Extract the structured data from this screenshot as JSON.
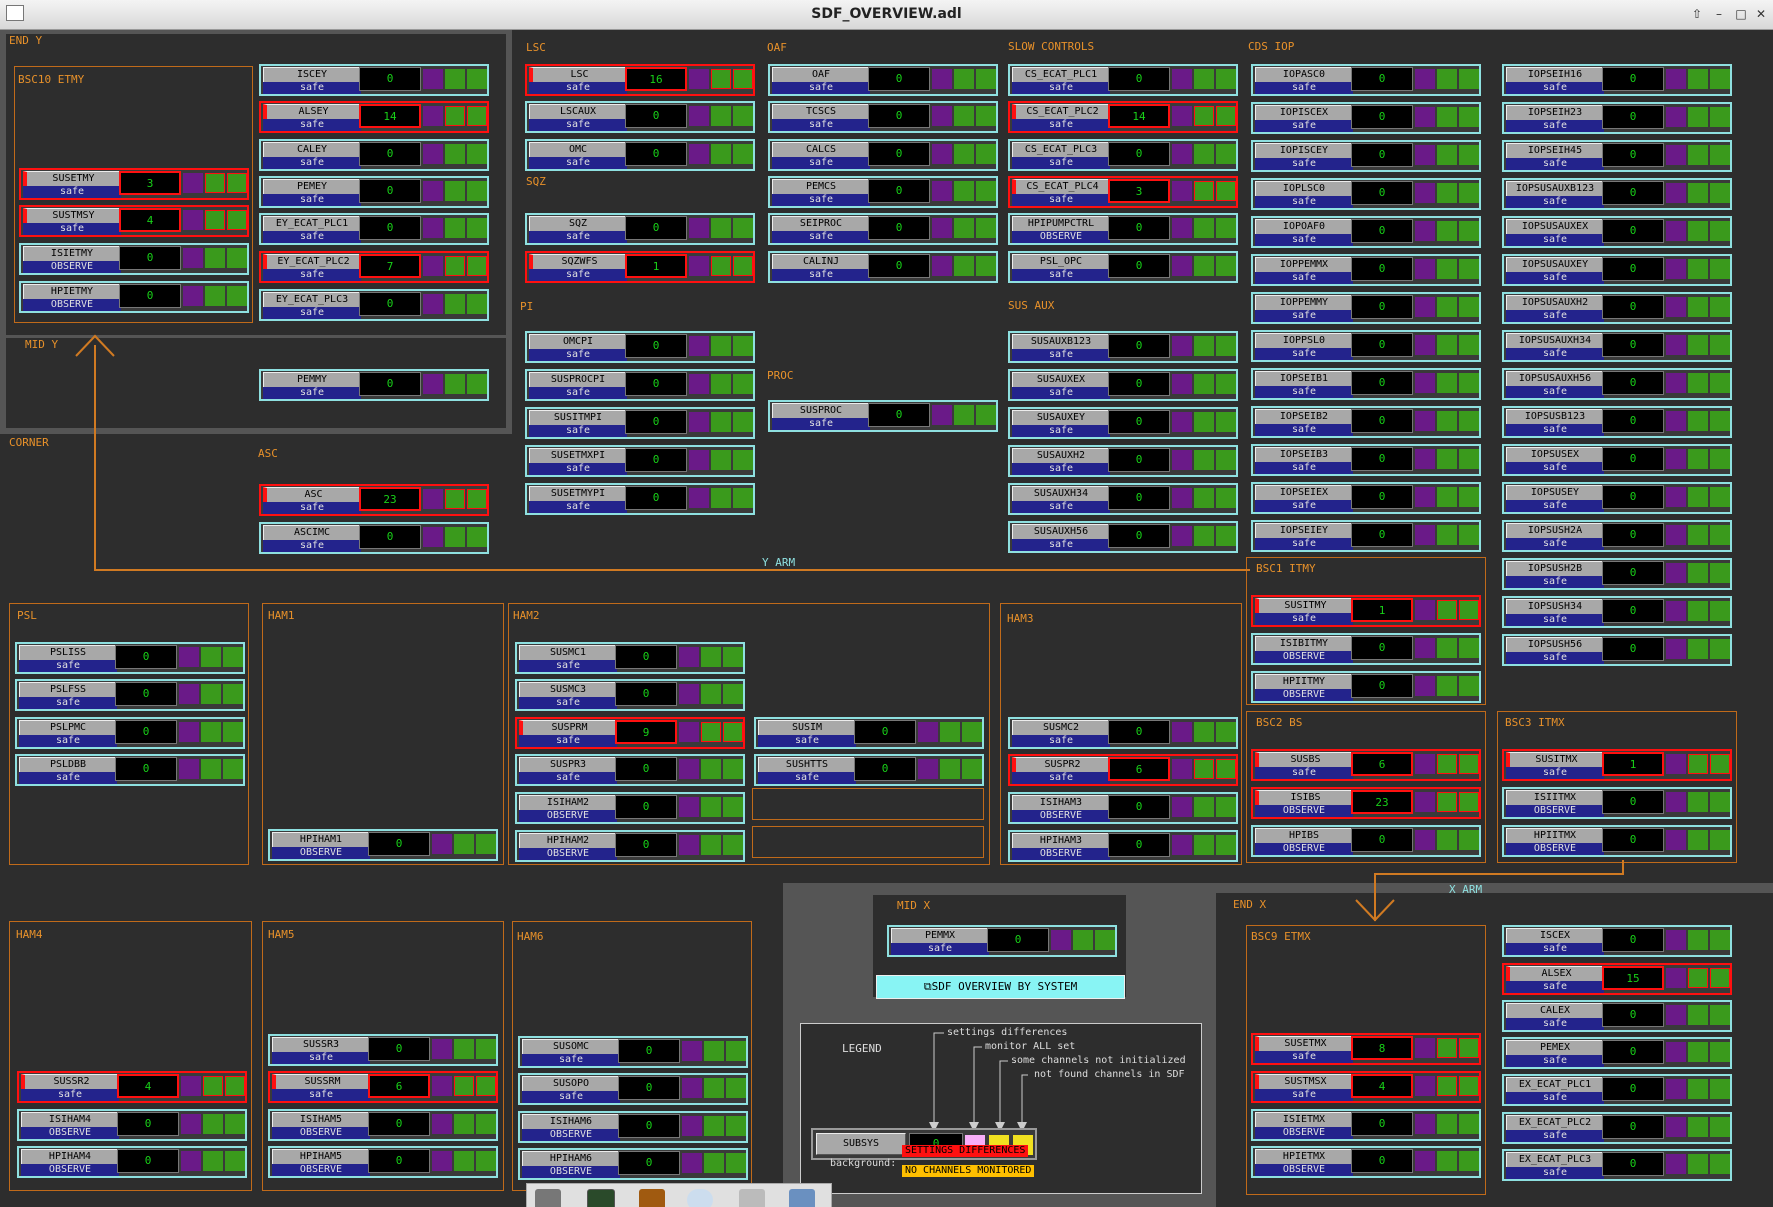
{
  "window": {
    "title": "SDF_OVERVIEW.adl"
  },
  "sections": {
    "end_y": "END Y",
    "bsc10": "BSC10 ETMY",
    "mid_y": "MID Y",
    "corner": "CORNER",
    "asc": "ASC",
    "lsc": "LSC",
    "sqz": "SQZ",
    "pi": "PI",
    "oaf": "OAF",
    "proc": "PROC",
    "slow": "SLOW CONTROLS",
    "sus_aux": "SUS AUX",
    "cds_iop": "CDS IOP",
    "y_arm": "Y ARM",
    "x_arm": "X ARM",
    "bsc1": "BSC1 ITMY",
    "bsc2": "BSC2 BS",
    "bsc3": "BSC3 ITMX",
    "psl": "PSL",
    "ham1": "HAM1",
    "ham2": "HAM2",
    "ham3": "HAM3",
    "ham4": "HAM4",
    "ham5": "HAM5",
    "ham6": "HAM6",
    "mid_x": "MID X",
    "end_x": "END X",
    "bsc9": "BSC9 ETMX"
  },
  "button": {
    "overview_label": "SDF OVERVIEW BY SYSTEM"
  },
  "legend": {
    "title": "LEGEND",
    "settings_diff": "settings differences",
    "monitor_all": "monitor ALL set",
    "not_init": "some channels not initialized",
    "not_found": "not found channels in SDF",
    "sample_name": "SUBSYS",
    "sample_count": "0",
    "background_label": "background:",
    "bg_settings": "SETTINGS DIFFERENCES",
    "bg_no_channels": "NO CHANNELS MONITORED"
  },
  "widgets": [
    {
      "n": "SUSETMY",
      "s": "safe",
      "c": "3",
      "a": 1
    },
    {
      "n": "SUSTMSY",
      "s": "safe",
      "c": "4",
      "a": 1
    },
    {
      "n": "ISIETMY",
      "s": "OBSERVE",
      "c": "0",
      "a": 0
    },
    {
      "n": "HPIETMY",
      "s": "OBSERVE",
      "c": "0",
      "a": 0
    },
    {
      "n": "ISCEY",
      "s": "safe",
      "c": "0",
      "a": 0
    },
    {
      "n": "ALSEY",
      "s": "safe",
      "c": "14",
      "a": 1
    },
    {
      "n": "CALEY",
      "s": "safe",
      "c": "0",
      "a": 0
    },
    {
      "n": "PEMEY",
      "s": "safe",
      "c": "0",
      "a": 0
    },
    {
      "n": "EY_ECAT_PLC1",
      "s": "safe",
      "c": "0",
      "a": 0
    },
    {
      "n": "EY_ECAT_PLC2",
      "s": "safe",
      "c": "7",
      "a": 1
    },
    {
      "n": "EY_ECAT_PLC3",
      "s": "safe",
      "c": "0",
      "a": 0
    },
    {
      "n": "PEMMY",
      "s": "safe",
      "c": "0",
      "a": 0
    },
    {
      "n": "ASC",
      "s": "safe",
      "c": "23",
      "a": 1
    },
    {
      "n": "ASCIMC",
      "s": "safe",
      "c": "0",
      "a": 0
    },
    {
      "n": "LSC",
      "s": "safe",
      "c": "16",
      "a": 1
    },
    {
      "n": "LSCAUX",
      "s": "safe",
      "c": "0",
      "a": 0
    },
    {
      "n": "OMC",
      "s": "safe",
      "c": "0",
      "a": 0
    },
    {
      "n": "SQZ",
      "s": "safe",
      "c": "0",
      "a": 0
    },
    {
      "n": "SQZWFS",
      "s": "safe",
      "c": "1",
      "a": 1
    },
    {
      "n": "OMCPI",
      "s": "safe",
      "c": "0",
      "a": 0
    },
    {
      "n": "SUSPROCPI",
      "s": "safe",
      "c": "0",
      "a": 0
    },
    {
      "n": "SUSITMPI",
      "s": "safe",
      "c": "0",
      "a": 0
    },
    {
      "n": "SUSETMXPI",
      "s": "safe",
      "c": "0",
      "a": 0
    },
    {
      "n": "SUSETMYPI",
      "s": "safe",
      "c": "0",
      "a": 0
    },
    {
      "n": "OAF",
      "s": "safe",
      "c": "0",
      "a": 0
    },
    {
      "n": "TCSCS",
      "s": "safe",
      "c": "0",
      "a": 0
    },
    {
      "n": "CALCS",
      "s": "safe",
      "c": "0",
      "a": 0
    },
    {
      "n": "PEMCS",
      "s": "safe",
      "c": "0",
      "a": 0
    },
    {
      "n": "SEIPROC",
      "s": "safe",
      "c": "0",
      "a": 0
    },
    {
      "n": "CALINJ",
      "s": "safe",
      "c": "0",
      "a": 0
    },
    {
      "n": "SUSPROC",
      "s": "safe",
      "c": "0",
      "a": 0
    },
    {
      "n": "CS_ECAT_PLC1",
      "s": "safe",
      "c": "0",
      "a": 0
    },
    {
      "n": "CS_ECAT_PLC2",
      "s": "safe",
      "c": "14",
      "a": 1
    },
    {
      "n": "CS_ECAT_PLC3",
      "s": "safe",
      "c": "0",
      "a": 0
    },
    {
      "n": "CS_ECAT_PLC4",
      "s": "safe",
      "c": "3",
      "a": 1
    },
    {
      "n": "HPIPUMPCTRL",
      "s": "OBSERVE",
      "c": "0",
      "a": 0
    },
    {
      "n": "PSL_OPC",
      "s": "safe",
      "c": "0",
      "a": 0
    },
    {
      "n": "SUSAUXB123",
      "s": "safe",
      "c": "0",
      "a": 0
    },
    {
      "n": "SUSAUXEX",
      "s": "safe",
      "c": "0",
      "a": 0
    },
    {
      "n": "SUSAUXEY",
      "s": "safe",
      "c": "0",
      "a": 0
    },
    {
      "n": "SUSAUXH2",
      "s": "safe",
      "c": "0",
      "a": 0
    },
    {
      "n": "SUSAUXH34",
      "s": "safe",
      "c": "0",
      "a": 0
    },
    {
      "n": "SUSAUXH56",
      "s": "safe",
      "c": "0",
      "a": 0
    },
    {
      "n": "IOPASC0",
      "s": "safe",
      "c": "0",
      "a": 0
    },
    {
      "n": "IOPISCEX",
      "s": "safe",
      "c": "0",
      "a": 0
    },
    {
      "n": "IOPISCEY",
      "s": "safe",
      "c": "0",
      "a": 0
    },
    {
      "n": "IOPLSC0",
      "s": "safe",
      "c": "0",
      "a": 0
    },
    {
      "n": "IOPOAF0",
      "s": "safe",
      "c": "0",
      "a": 0
    },
    {
      "n": "IOPPEMMX",
      "s": "safe",
      "c": "0",
      "a": 0
    },
    {
      "n": "IOPPEMMY",
      "s": "safe",
      "c": "0",
      "a": 0
    },
    {
      "n": "IOPPSL0",
      "s": "safe",
      "c": "0",
      "a": 0
    },
    {
      "n": "IOPSEIB1",
      "s": "safe",
      "c": "0",
      "a": 0
    },
    {
      "n": "IOPSEIB2",
      "s": "safe",
      "c": "0",
      "a": 0
    },
    {
      "n": "IOPSEIB3",
      "s": "safe",
      "c": "0",
      "a": 0
    },
    {
      "n": "IOPSEIEX",
      "s": "safe",
      "c": "0",
      "a": 0
    },
    {
      "n": "IOPSEIEY",
      "s": "safe",
      "c": "0",
      "a": 0
    },
    {
      "n": "IOPSEIH16",
      "s": "safe",
      "c": "0",
      "a": 0
    },
    {
      "n": "IOPSEIH23",
      "s": "safe",
      "c": "0",
      "a": 0
    },
    {
      "n": "IOPSEIH45",
      "s": "safe",
      "c": "0",
      "a": 0
    },
    {
      "n": "IOPSUSAUXB123",
      "s": "safe",
      "c": "0",
      "a": 0
    },
    {
      "n": "IOPSUSAUXEX",
      "s": "safe",
      "c": "0",
      "a": 0
    },
    {
      "n": "IOPSUSAUXEY",
      "s": "safe",
      "c": "0",
      "a": 0
    },
    {
      "n": "IOPSUSAUXH2",
      "s": "safe",
      "c": "0",
      "a": 0
    },
    {
      "n": "IOPSUSAUXH34",
      "s": "safe",
      "c": "0",
      "a": 0
    },
    {
      "n": "IOPSUSAUXH56",
      "s": "safe",
      "c": "0",
      "a": 0
    },
    {
      "n": "IOPSUSB123",
      "s": "safe",
      "c": "0",
      "a": 0
    },
    {
      "n": "IOPSUSEX",
      "s": "safe",
      "c": "0",
      "a": 0
    },
    {
      "n": "IOPSUSEY",
      "s": "safe",
      "c": "0",
      "a": 0
    },
    {
      "n": "IOPSUSH2A",
      "s": "safe",
      "c": "0",
      "a": 0
    },
    {
      "n": "IOPSUSH2B",
      "s": "safe",
      "c": "0",
      "a": 0
    },
    {
      "n": "IOPSUSH34",
      "s": "safe",
      "c": "0",
      "a": 0
    },
    {
      "n": "IOPSUSH56",
      "s": "safe",
      "c": "0",
      "a": 0
    },
    {
      "n": "SUSITMY",
      "s": "safe",
      "c": "1",
      "a": 1
    },
    {
      "n": "ISIBITMY",
      "s": "OBSERVE",
      "c": "0",
      "a": 0
    },
    {
      "n": "HPIITMY",
      "s": "OBSERVE",
      "c": "0",
      "a": 0
    },
    {
      "n": "SUSBS",
      "s": "safe",
      "c": "6",
      "a": 1
    },
    {
      "n": "ISIBS",
      "s": "OBSERVE",
      "c": "23",
      "a": 1
    },
    {
      "n": "HPIBS",
      "s": "OBSERVE",
      "c": "0",
      "a": 0
    },
    {
      "n": "SUSITMX",
      "s": "safe",
      "c": "1",
      "a": 1
    },
    {
      "n": "ISIITMX",
      "s": "OBSERVE",
      "c": "0",
      "a": 0
    },
    {
      "n": "HPIITMX",
      "s": "OBSERVE",
      "c": "0",
      "a": 0
    },
    {
      "n": "PSLISS",
      "s": "safe",
      "c": "0",
      "a": 0
    },
    {
      "n": "PSLFSS",
      "s": "safe",
      "c": "0",
      "a": 0
    },
    {
      "n": "PSLPMC",
      "s": "safe",
      "c": "0",
      "a": 0
    },
    {
      "n": "PSLDBB",
      "s": "safe",
      "c": "0",
      "a": 0
    },
    {
      "n": "HPIHAM1",
      "s": "OBSERVE",
      "c": "0",
      "a": 0
    },
    {
      "n": "SUSMC1",
      "s": "safe",
      "c": "0",
      "a": 0
    },
    {
      "n": "SUSMC3",
      "s": "safe",
      "c": "0",
      "a": 0
    },
    {
      "n": "SUSPRM",
      "s": "safe",
      "c": "9",
      "a": 1
    },
    {
      "n": "SUSPR3",
      "s": "safe",
      "c": "0",
      "a": 0
    },
    {
      "n": "ISIHAM2",
      "s": "OBSERVE",
      "c": "0",
      "a": 0
    },
    {
      "n": "HPIHAM2",
      "s": "OBSERVE",
      "c": "0",
      "a": 0
    },
    {
      "n": "SUSIM",
      "s": "safe",
      "c": "0",
      "a": 0
    },
    {
      "n": "SUSHTTS",
      "s": "safe",
      "c": "0",
      "a": 0
    },
    {
      "n": "SUSMC2",
      "s": "safe",
      "c": "0",
      "a": 0
    },
    {
      "n": "SUSPR2",
      "s": "safe",
      "c": "6",
      "a": 1
    },
    {
      "n": "ISIHAM3",
      "s": "OBSERVE",
      "c": "0",
      "a": 0
    },
    {
      "n": "HPIHAM3",
      "s": "OBSERVE",
      "c": "0",
      "a": 0
    },
    {
      "n": "SUSSR2",
      "s": "safe",
      "c": "4",
      "a": 1
    },
    {
      "n": "ISIHAM4",
      "s": "OBSERVE",
      "c": "0",
      "a": 0
    },
    {
      "n": "HPIHAM4",
      "s": "OBSERVE",
      "c": "0",
      "a": 0
    },
    {
      "n": "SUSSR3",
      "s": "safe",
      "c": "0",
      "a": 0
    },
    {
      "n": "SUSSRM",
      "s": "safe",
      "c": "6",
      "a": 1
    },
    {
      "n": "ISIHAM5",
      "s": "OBSERVE",
      "c": "0",
      "a": 0
    },
    {
      "n": "HPIHAM5",
      "s": "OBSERVE",
      "c": "0",
      "a": 0
    },
    {
      "n": "SUSOMC",
      "s": "safe",
      "c": "0",
      "a": 0
    },
    {
      "n": "SUSOPO",
      "s": "safe",
      "c": "0",
      "a": 0
    },
    {
      "n": "ISIHAM6",
      "s": "OBSERVE",
      "c": "0",
      "a": 0
    },
    {
      "n": "HPIHAM6",
      "s": "OBSERVE",
      "c": "0",
      "a": 0
    },
    {
      "n": "PEMMX",
      "s": "safe",
      "c": "0",
      "a": 0
    },
    {
      "n": "SUSETMX",
      "s": "safe",
      "c": "8",
      "a": 1
    },
    {
      "n": "SUSTMSX",
      "s": "safe",
      "c": "4",
      "a": 1
    },
    {
      "n": "ISIETMX",
      "s": "OBSERVE",
      "c": "0",
      "a": 0
    },
    {
      "n": "HPIETMX",
      "s": "OBSERVE",
      "c": "0",
      "a": 0
    },
    {
      "n": "ISCEX",
      "s": "safe",
      "c": "0",
      "a": 0
    },
    {
      "n": "ALSEX",
      "s": "safe",
      "c": "15",
      "a": 1
    },
    {
      "n": "CALEX",
      "s": "safe",
      "c": "0",
      "a": 0
    },
    {
      "n": "PEMEX",
      "s": "safe",
      "c": "0",
      "a": 0
    },
    {
      "n": "EX_ECAT_PLC1",
      "s": "safe",
      "c": "0",
      "a": 0
    },
    {
      "n": "EX_ECAT_PLC2",
      "s": "safe",
      "c": "0",
      "a": 0
    },
    {
      "n": "EX_ECAT_PLC3",
      "s": "safe",
      "c": "0",
      "a": 0
    }
  ]
}
